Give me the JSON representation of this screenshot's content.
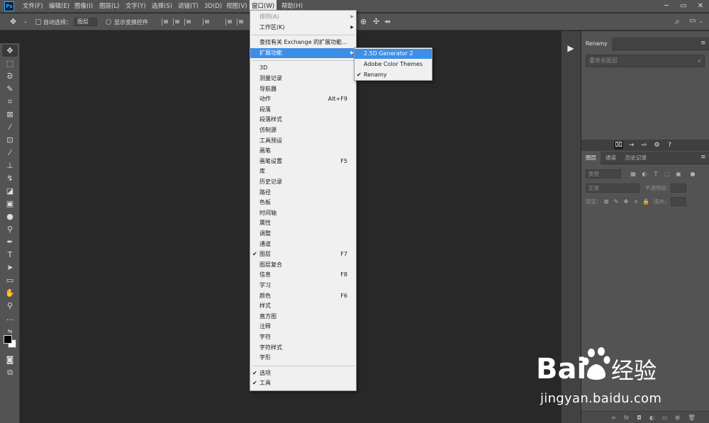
{
  "app": {
    "logo_text": "Ps"
  },
  "menubar": {
    "items": [
      {
        "label": "文件(F)"
      },
      {
        "label": "编辑(E)"
      },
      {
        "label": "图像(I)"
      },
      {
        "label": "图层(L)"
      },
      {
        "label": "文字(Y)"
      },
      {
        "label": "选择(S)"
      },
      {
        "label": "滤镜(T)"
      },
      {
        "label": "3D(D)"
      },
      {
        "label": "视图(V)"
      },
      {
        "label": "窗口(W)",
        "active": true
      },
      {
        "label": "帮助(H)"
      }
    ],
    "window_controls": [
      "─",
      "▭",
      "✕"
    ]
  },
  "options_bar": {
    "auto_select_label": "自动选择：",
    "auto_select_value": "图层",
    "show_transform_label": "显示变换控件"
  },
  "window_menu": {
    "items": [
      {
        "label": "排列(A)",
        "submenu": true,
        "disabled": true
      },
      {
        "label": "工作区(K)",
        "submenu": true
      },
      {
        "sep": true
      },
      {
        "label": "查找有关 Exchange 的扩展功能..."
      },
      {
        "label": "扩展功能",
        "submenu": true,
        "highlighted": true
      },
      {
        "sep": true
      },
      {
        "label": "3D"
      },
      {
        "label": "测量记录"
      },
      {
        "label": "导航器"
      },
      {
        "label": "动作",
        "shortcut": "Alt+F9"
      },
      {
        "label": "段落"
      },
      {
        "label": "段落样式"
      },
      {
        "label": "仿制源"
      },
      {
        "label": "工具预设"
      },
      {
        "label": "画笔"
      },
      {
        "label": "画笔设置",
        "shortcut": "F5"
      },
      {
        "label": "库"
      },
      {
        "label": "历史记录"
      },
      {
        "label": "路径"
      },
      {
        "label": "色板"
      },
      {
        "label": "时间轴"
      },
      {
        "label": "属性"
      },
      {
        "label": "调整"
      },
      {
        "label": "通道"
      },
      {
        "label": "图层",
        "shortcut": "F7",
        "checked": true
      },
      {
        "label": "图层复合"
      },
      {
        "label": "信息",
        "shortcut": "F8"
      },
      {
        "label": "学习"
      },
      {
        "label": "颜色",
        "shortcut": "F6"
      },
      {
        "label": "样式"
      },
      {
        "label": "直方图"
      },
      {
        "label": "注释"
      },
      {
        "label": "字符"
      },
      {
        "label": "字符样式"
      },
      {
        "label": "字形"
      },
      {
        "sep": true
      },
      {
        "label": "选项",
        "checked": true
      },
      {
        "label": "工具",
        "checked": true
      }
    ]
  },
  "extensions_submenu": {
    "items": [
      {
        "label": "2.5D Generator 2",
        "highlighted": true
      },
      {
        "label": "Adobe Color Themes"
      },
      {
        "label": "Renamy",
        "checked": true
      }
    ]
  },
  "renamy_panel": {
    "tab": "Renamy",
    "search_placeholder": "重命名图层"
  },
  "layers_panel": {
    "tabs": [
      {
        "label": "图层",
        "active": true
      },
      {
        "label": "通道"
      },
      {
        "label": "历史记录"
      }
    ],
    "filter_type": "类型",
    "blend_mode": "正常",
    "opacity_label": "不透明度：",
    "lock_label": "锁定：",
    "fill_label": "填充："
  },
  "watermark": {
    "brand": "Bai",
    "brand_cn": "经验",
    "url": "jingyan.baidu.com"
  }
}
